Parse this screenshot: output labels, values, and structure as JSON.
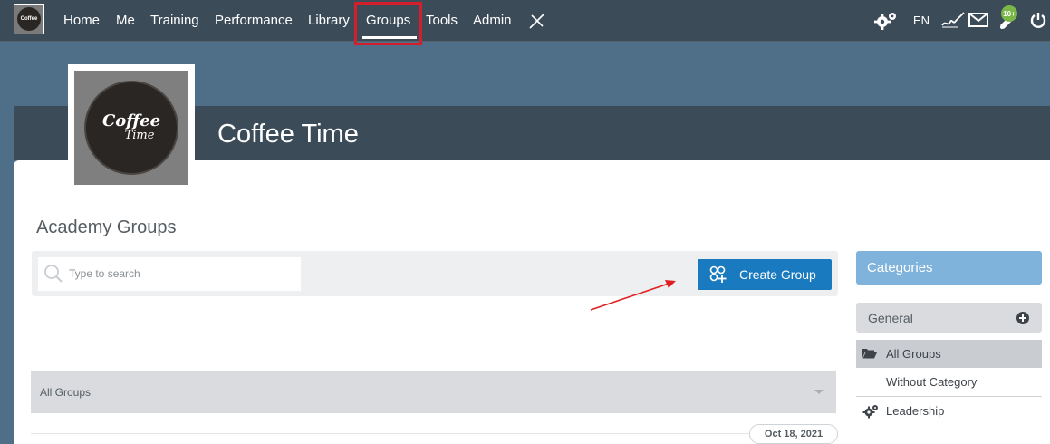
{
  "nav": {
    "items": [
      "Home",
      "Me",
      "Training",
      "Performance",
      "Library",
      "Groups",
      "Tools",
      "Admin"
    ],
    "active": "Groups",
    "language": "EN",
    "notification_badge": "10+",
    "logo_text": "Coffee"
  },
  "banner": {
    "group_title": "Coffee Time",
    "image_word1": "Coffee",
    "image_word2": "Time"
  },
  "main": {
    "title": "Academy Groups",
    "search_placeholder": "Type to search",
    "create_group_label": "Create Group",
    "filter_value": "All Groups",
    "date_label": "Oct 18, 2021"
  },
  "sidebar": {
    "header": "Categories",
    "section": "General",
    "items": [
      "All Groups",
      "Without Category",
      "Leadership"
    ],
    "active_item": "All Groups"
  },
  "colors": {
    "nav_bg": "#3c4b58",
    "primary_button": "#1a7abf",
    "categories_header": "#7fb3db",
    "highlight": "#d21f2b",
    "badge": "#7ab648"
  }
}
